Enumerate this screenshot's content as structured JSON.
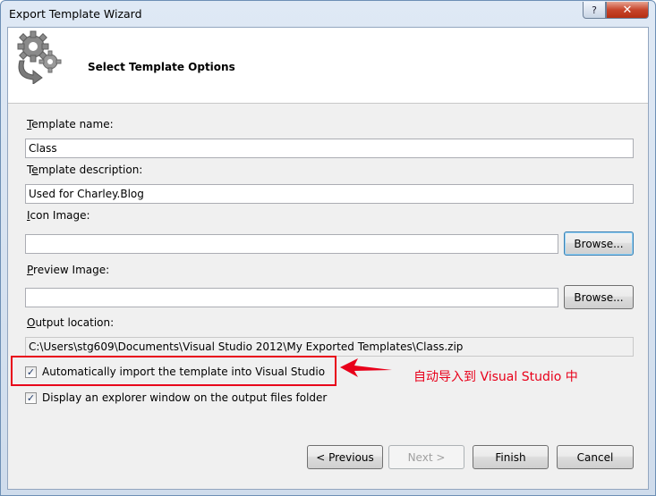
{
  "window": {
    "title": "Export Template Wizard",
    "help_glyph": "?",
    "close_glyph": "✕"
  },
  "header": {
    "title": "Select Template Options",
    "icon": "gears-export-icon"
  },
  "form": {
    "template_name": {
      "label": "Template name:",
      "accesskey": "T",
      "value": "Class"
    },
    "template_description": {
      "label": "Template description:",
      "accesskey": "e",
      "value": "Used for Charley.Blog"
    },
    "icon_image": {
      "label": "Icon Image:",
      "accesskey": "I",
      "value": "",
      "browse_label": "Browse..."
    },
    "preview_image": {
      "label": "Preview Image:",
      "accesskey": "P",
      "value": "",
      "browse_label": "Browse..."
    },
    "output_location": {
      "label": "Output location:",
      "accesskey": "O",
      "value": "C:\\Users\\stg609\\Documents\\Visual Studio 2012\\My Exported Templates\\Class.zip"
    },
    "auto_import": {
      "label": "Automatically import the template into Visual Studio",
      "checked": true
    },
    "display_explorer": {
      "label": "Display an explorer window on the output files folder",
      "checked": true
    }
  },
  "annotation": {
    "text": "自动导入到 Visual Studio 中",
    "color": "#e8001a"
  },
  "footer": {
    "previous_label": "< Previous",
    "next_label": "Next >",
    "finish_label": "Finish",
    "cancel_label": "Cancel"
  }
}
